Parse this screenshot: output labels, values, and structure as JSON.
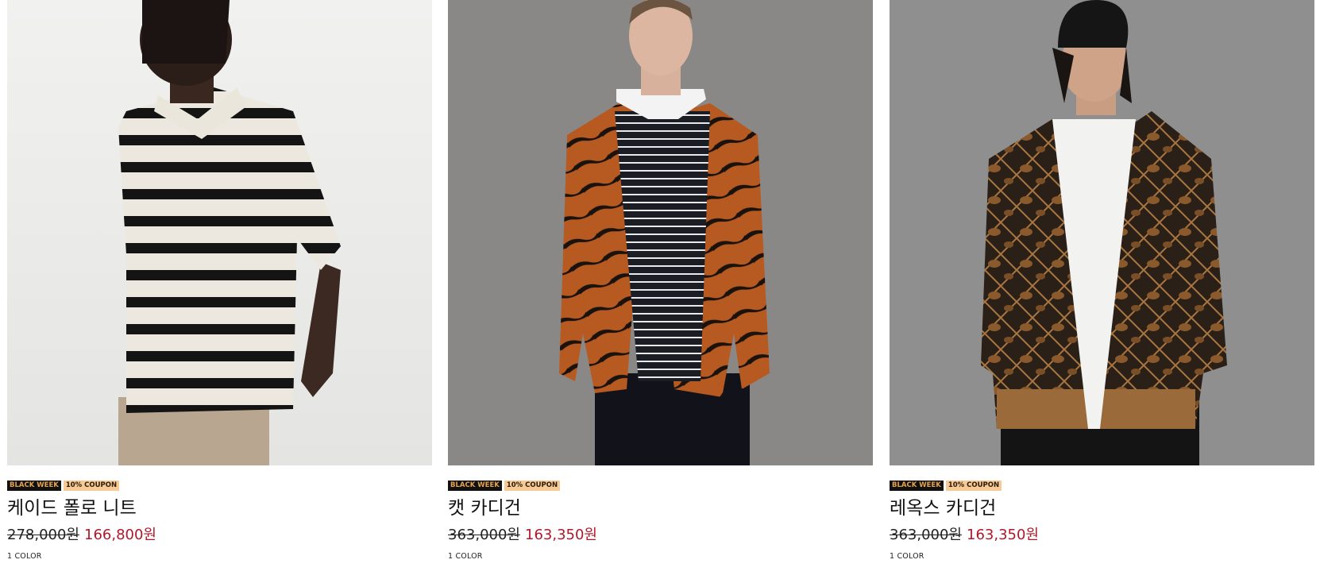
{
  "products": [
    {
      "badge_event": "BLACK WEEK",
      "badge_coupon": "10% COUPON",
      "name": "케이드 폴로 니트",
      "original_price": "278,000원",
      "sale_price": "166,800원",
      "colors": "1 COLOR"
    },
    {
      "badge_event": "BLACK WEEK",
      "badge_coupon": "10% COUPON",
      "name": "캣 카디건",
      "original_price": "363,000원",
      "sale_price": "163,350원",
      "colors": "1 COLOR"
    },
    {
      "badge_event": "BLACK WEEK",
      "badge_coupon": "10% COUPON",
      "name": "레옥스 카디건",
      "original_price": "363,000원",
      "sale_price": "163,350원",
      "colors": "1 COLOR"
    }
  ],
  "colors": {
    "sale_price": "#b0182a",
    "badge_dark_bg": "#111111",
    "badge_dark_text": "#e9a24c",
    "badge_light_bg": "#f6c995"
  }
}
